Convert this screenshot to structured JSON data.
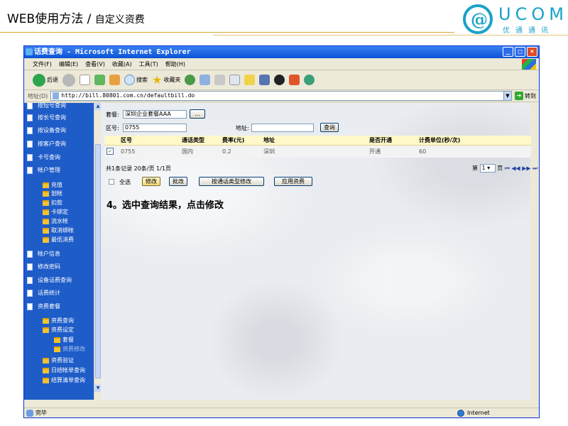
{
  "slide": {
    "title_main": "WEB使用方法 /",
    "title_sub": "自定义资费",
    "logo_word": "UCOM",
    "logo_cn": "优通通讯"
  },
  "window": {
    "title": "话费查询 - Microsoft Internet Explorer"
  },
  "menu": [
    "文件(F)",
    "编辑(E)",
    "查看(V)",
    "收藏(A)",
    "工具(T)",
    "帮助(H)"
  ],
  "toolbar": {
    "back": "后退",
    "search": "搜索",
    "favorites": "收藏夹"
  },
  "address": {
    "label": "地址(D)",
    "url": "http://bill.80801.com.cn/defaultbill.do",
    "go": "转到"
  },
  "sidebar": {
    "top_items": [
      "按短号查询",
      "按长号查询",
      "按设备查询",
      "按客户查询",
      "卡号查询",
      "帐户管理"
    ],
    "account_subs": [
      "充值",
      "划帐",
      "扣款",
      "卡绑定",
      "流水帐",
      "取消绑帐",
      "最低消费"
    ],
    "mid_items": [
      "帐户信息",
      "修改密码",
      "设备话费查询",
      "话费统计",
      "资费套餐"
    ],
    "tariff_subs": [
      "资费查询",
      "资费设定"
    ],
    "tariff_set_subs": [
      "套餐",
      "资费修改"
    ],
    "tariff_more": [
      "资费验证",
      "日结帐单查询",
      "结算清单查询"
    ]
  },
  "form": {
    "package_label": "套餐:",
    "package_value": "深圳企业套餐AAA",
    "browse_button": "...",
    "area_label": "区号:",
    "area_value": "0755",
    "address_label": "地址:",
    "address_value": "",
    "query_button": "查询"
  },
  "table": {
    "headers": [
      "",
      "区号",
      "通话类型",
      "费率(元)",
      "地址",
      "是否开通",
      "计费单位(秒/次)"
    ],
    "rows": [
      {
        "checked": "✓",
        "area": "0755",
        "type": "国内",
        "rate": "0.2",
        "addr": "深圳",
        "open": "开通",
        "unit": "60"
      }
    ]
  },
  "pager": {
    "summary": "共1条记录  20条/页  1/1页",
    "page_prefix": "第",
    "page_value": "1",
    "page_suffix": "页",
    "nav_first": "⏮",
    "nav_prev": "◀◀",
    "nav_next": "▶▶",
    "nav_last": "⏭"
  },
  "actions": {
    "select_all": "全选",
    "modify": "修改",
    "batch_modify": "批改",
    "modify_by_type": "按通话类型修改",
    "apply_tariff": "应用资费"
  },
  "instruction": "4。选中查询结果，点击修改",
  "status": {
    "left": "完毕",
    "zone": "Internet"
  },
  "colors": {
    "title_bar": "#0a53d6",
    "sidebar": "#1e5cc8",
    "header_row": "#fff8c8",
    "logo": "#1aa2c9"
  }
}
